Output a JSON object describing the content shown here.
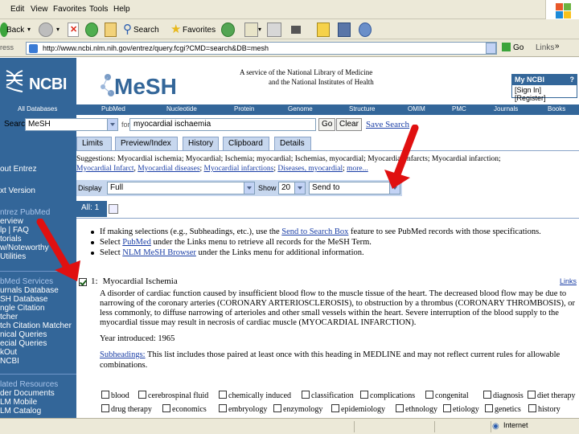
{
  "browser": {
    "menu": [
      "Edit",
      "View",
      "Favorites",
      "Tools",
      "Help"
    ],
    "toolbar": {
      "back_label": "Back",
      "search_label": "Search",
      "favorites_label": "Favorites"
    },
    "address": {
      "url": "http://www.ncbi.nlm.nih.gov/entrez/query.fcgi?CMD=search&DB=mesh",
      "go_label": "Go",
      "links_label": "Links"
    },
    "status": {
      "zone": "Internet"
    }
  },
  "header": {
    "ncbi_logo": "NCBI",
    "mesh_logo": "MeSH",
    "service_line1": "A service of the National Library of Medicine",
    "service_line2": "and the National Institutes of Health",
    "my_ncbi": "My NCBI",
    "help_mark": "?",
    "sign_in": "[Sign In] [Register]"
  },
  "nav": [
    "All Databases",
    "PubMed",
    "Nucleotide",
    "Protein",
    "Genome",
    "Structure",
    "OMIM",
    "PMC",
    "Journals",
    "Books"
  ],
  "sidebar": {
    "items": [
      {
        "label": "out Entrez",
        "section": false
      },
      {
        "label": "xt Version",
        "section": false
      },
      {
        "label": "ntrez PubMed",
        "section": true
      },
      {
        "label": "erview",
        "section": false
      },
      {
        "label": "lp | FAQ",
        "section": false
      },
      {
        "label": "torials",
        "section": false
      },
      {
        "label": "w/Noteworthy",
        "section": false
      },
      {
        "label": "Utilities",
        "section": false
      },
      {
        "label": "bMed Services",
        "section": true
      },
      {
        "label": "urnals Database",
        "section": false
      },
      {
        "label": "SH Database",
        "section": false
      },
      {
        "label": "ngle Citation",
        "section": false
      },
      {
        "label": "tcher",
        "section": false
      },
      {
        "label": "tch Citation Matcher",
        "section": false
      },
      {
        "label": "nical Queries",
        "section": false
      },
      {
        "label": "ecial Queries",
        "section": false
      },
      {
        "label": "kOut",
        "section": false
      },
      {
        "label": "NCBI",
        "section": false
      },
      {
        "label": "lated Resources",
        "section": true
      },
      {
        "label": "der Documents",
        "section": false
      },
      {
        "label": "LM Mobile",
        "section": false
      },
      {
        "label": "LM Catalog",
        "section": false
      }
    ]
  },
  "search": {
    "label": "Search",
    "database": "MeSH",
    "for_label": "for",
    "term": "myocardial ischaemia",
    "go_label": "Go",
    "clear_label": "Clear",
    "save_search": "Save Search"
  },
  "tabs": [
    "Limits",
    "Preview/Index",
    "History",
    "Clipboard",
    "Details"
  ],
  "suggestions": {
    "intro": "Suggestions: Myocardial ischemia; Myocardial; Ischemia; myocardial; Ischemias, myocardial; Myocardial infarcts; Myocardial infarction;",
    "links": [
      "Myocardial Infarct",
      "Myocardial diseases",
      "Myocardial infarctions",
      "Diseases, myocardial",
      "more..."
    ]
  },
  "display": {
    "display_label": "Display",
    "display_value": "Full",
    "show_label": "Show",
    "show_value": "20",
    "send_value": "Send to"
  },
  "all_tab": "All: 1",
  "bullets": [
    {
      "pre": "If making selections (e.g., Subheadings, etc.), use the ",
      "link": "Send to Search Box",
      "post": " feature to see PubMed records with those specifications."
    },
    {
      "pre": "Select ",
      "link": "PubMed",
      "post": " under the Links menu to retrieve all records for the MeSH Term."
    },
    {
      "pre": "Select ",
      "link": "NLM MeSH Browser",
      "post": " under the Links menu for additional information."
    }
  ],
  "result": {
    "number": "1:",
    "title": "Myocardial Ischemia",
    "links_label": "Links",
    "description": "A disorder of cardiac function caused by insufficient blood flow to the muscle tissue of the heart. The decreased blood flow may be due to narrowing of the coronary arteries (CORONARY ARTERIOSCLEROSIS), to obstruction by a thrombus (CORONARY THROMBOSIS), or less commonly, to diffuse narrowing of arterioles and other small vessels within the heart. Severe interruption of the blood supply to the myocardial tissue may result in necrosis of cardiac muscle (MYOCARDIAL INFARCTION).",
    "year": "Year introduced: 1965",
    "subheadings_link": "Subheadings:",
    "subheadings_text": " This list includes those paired at least once with this heading in MEDLINE and may not reflect current rules for allowable combinations."
  },
  "subheading_checkboxes": {
    "row1": [
      "blood",
      "cerebrospinal fluid",
      "chemically induced",
      "classification",
      "complications",
      "congenital",
      "diagnosis",
      "diet therapy"
    ],
    "row2": [
      "drug therapy",
      "economics",
      "embryology",
      "enzymology",
      "epidemiology",
      "ethnology",
      "etiology",
      "genetics",
      "history"
    ]
  },
  "colors": {
    "ncbi_blue": "#336699",
    "link_blue": "#1a3ea6",
    "arrow_red": "#e01010"
  }
}
